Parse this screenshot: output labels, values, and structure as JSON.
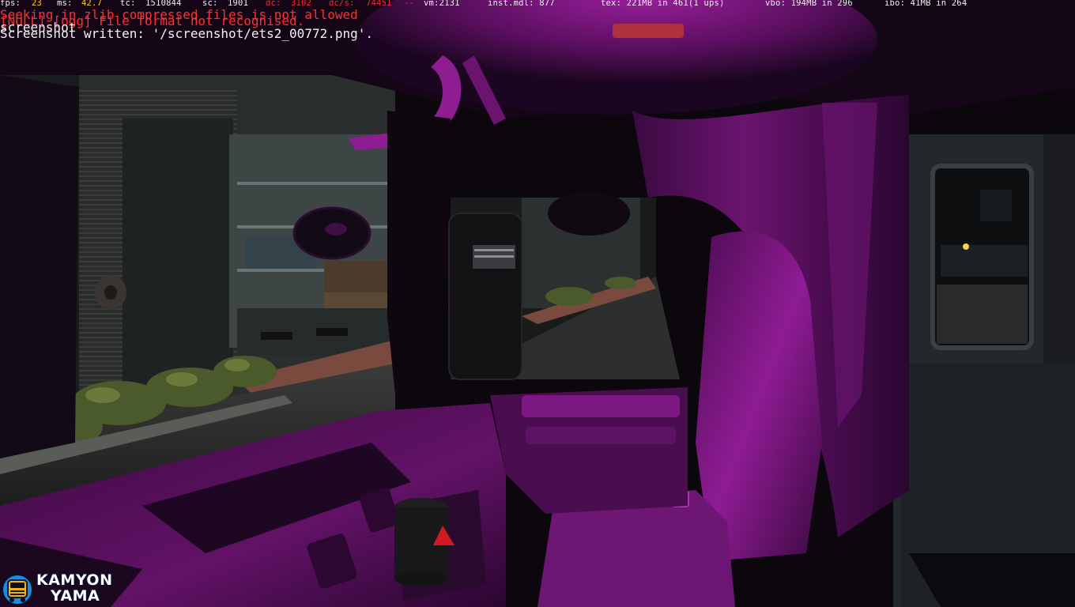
{
  "debug_hud": {
    "fps_label": "fps:",
    "fps": "23",
    "ms_label": "ms:",
    "ms": "42.7",
    "tc_label": "tc:",
    "tc": "1510844",
    "sc_label": "sc:",
    "sc": "1901",
    "dc_label": "dc:",
    "dc": "3102",
    "dcs_label": "dc/s:",
    "dcs": "74451",
    "dashes": "--",
    "vm": "vm:2131",
    "instmdl": "inst.mdl: 877",
    "tex": "tex: 221MB in 461(1 ups)",
    "vbo": "vbo: 194MB in 296",
    "ibo": "ibo: 41MB in 264"
  },
  "console": {
    "lines": [
      "Seeking in zlib compressed files is not allowed",
      "[NULL] [ogg] File format not recognised.",
      "screenshot",
      "Screenshot written: '/screenshot/ets2_00772.png'."
    ]
  },
  "watermark": {
    "line1": "KAMYON",
    "line2": "YAMA"
  },
  "colors": {
    "interior_magenta": "#8a1a8f",
    "hud_yellow": "#ffd400",
    "hud_red": "#ff2a2a",
    "text_white": "#f2f2f2"
  }
}
